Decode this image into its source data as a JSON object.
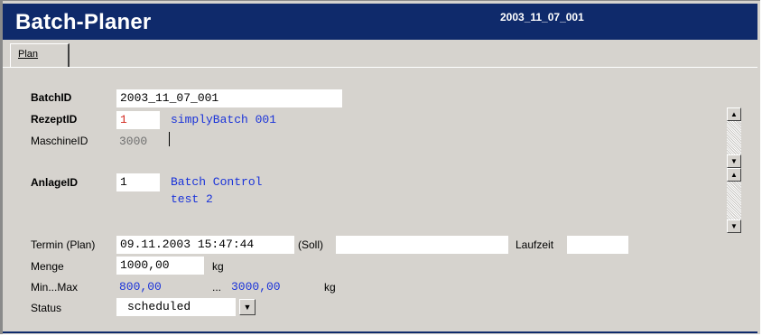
{
  "header": {
    "app_title": "Batch-Planer",
    "batch_id": "2003_11_07_001"
  },
  "tabs": [
    {
      "label": "Plan"
    }
  ],
  "form": {
    "batch_id": {
      "label": "BatchID",
      "value": "2003_11_07_001"
    },
    "rezept_id": {
      "label": "RezeptID",
      "value": "1",
      "name": "simplyBatch 001"
    },
    "maschine_id": {
      "label": "MaschineID",
      "value": "3000"
    },
    "anlage_id": {
      "label": "AnlageID",
      "value": "1",
      "name_line1": "Batch Control",
      "name_line2": "test 2"
    },
    "termin": {
      "label": "Termin (Plan)",
      "value": "09.11.2003 15:47:44",
      "soll_label": "(Soll)",
      "soll_value": "",
      "laufzeit_label": "Laufzeit",
      "laufzeit_value": ""
    },
    "menge": {
      "label": "Menge",
      "value": "1000,00",
      "unit": "kg"
    },
    "minmax": {
      "label": "Min...Max",
      "min": "800,00",
      "sep": "...",
      "max": "3000,00",
      "unit": "kg"
    },
    "status": {
      "label": "Status",
      "value": "scheduled"
    }
  },
  "icons": {
    "scroll_up": "scroll-up-icon",
    "scroll_down": "scroll-down-icon",
    "dropdown": "chevron-down-icon"
  },
  "colors": {
    "title_bar": "#0f2a6b",
    "value_blue": "#1a33d9",
    "value_red": "#d2281e",
    "panel": "#d6d3ce"
  }
}
